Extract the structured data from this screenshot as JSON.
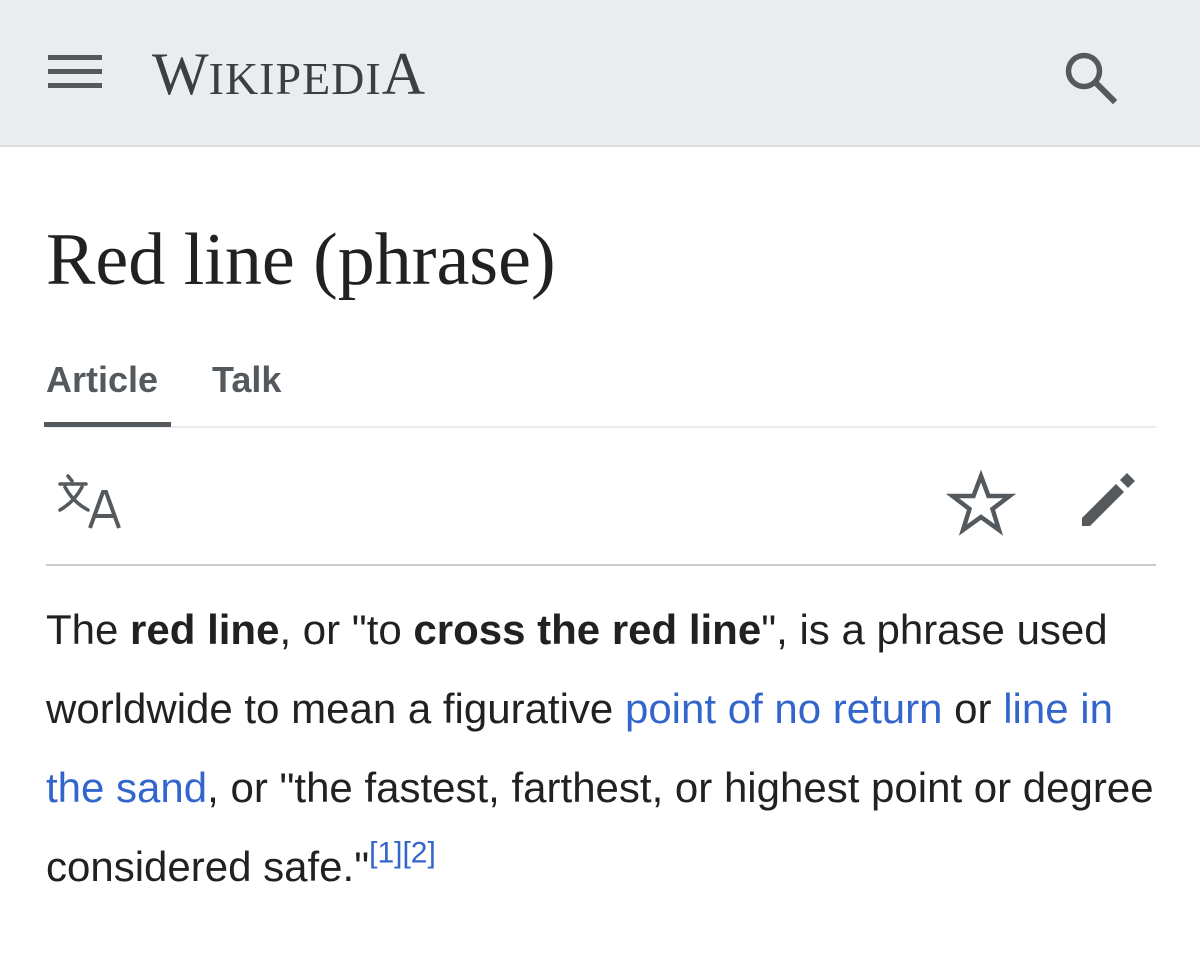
{
  "header": {
    "wordmark_caps": [
      "W",
      "IKIPEDI",
      "A"
    ],
    "menu_icon": "hamburger-menu-icon",
    "search_icon": "search-icon",
    "background": "#eaecf0"
  },
  "article": {
    "title": "Red line (phrase)"
  },
  "tabs": [
    {
      "label": "Article",
      "selected": true
    },
    {
      "label": "Talk",
      "selected": false
    }
  ],
  "toolbar": {
    "language_icon": "language-icon",
    "watch_icon": "star-icon",
    "edit_icon": "pencil-icon"
  },
  "lead": {
    "t1": "The ",
    "b1": "red line",
    "t2": ", or \"to ",
    "b2": "cross the red line",
    "t3": "\", is a phrase used worldwide to mean a figurative ",
    "link1": "point of no return",
    "t4": " or ",
    "link2": "line in the sand",
    "t5": ", or \"the fastest, farthest, or highest point or degree considered safe.\"",
    "ref1": "[1]",
    "ref2": "[2]"
  },
  "colors": {
    "link": "#3366cc",
    "text": "#202122",
    "icon": "#54595d"
  }
}
